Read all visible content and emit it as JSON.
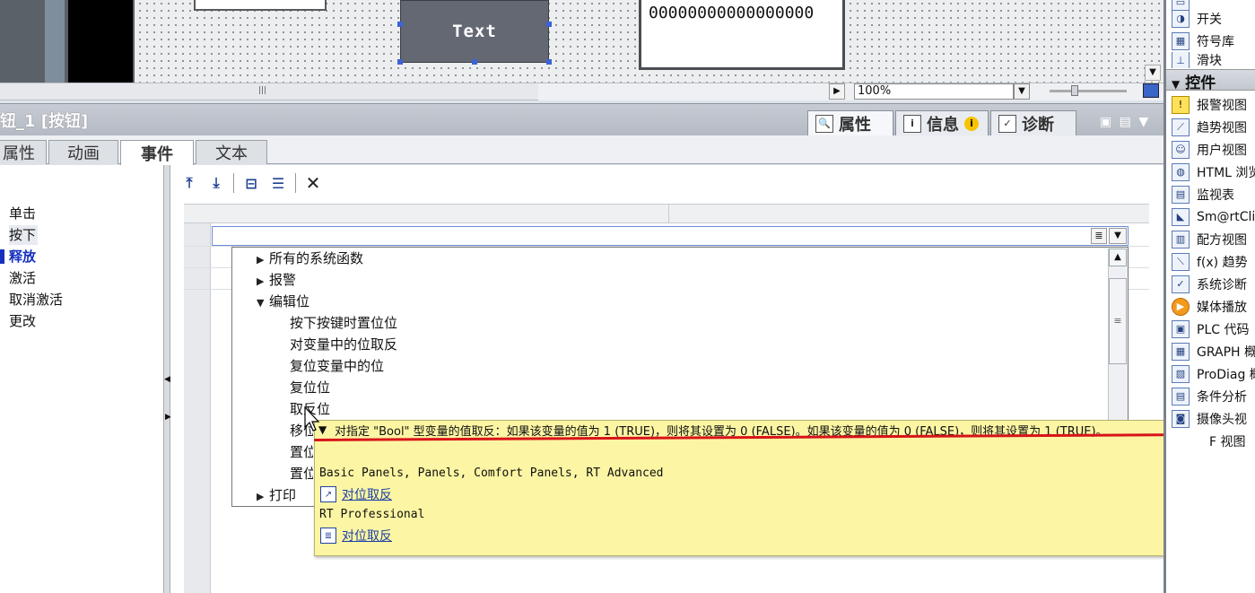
{
  "canvas": {
    "button_text": "Text",
    "io_field_value": "00000000000000000",
    "zoom_value": "100%"
  },
  "properties": {
    "title": "钮_1 [按钮]",
    "tabs": [
      {
        "label": "属性",
        "icon": "properties-icon"
      },
      {
        "label": "信息",
        "icon": "info-icon"
      },
      {
        "label": "诊断",
        "icon": "diagnostics-icon"
      }
    ],
    "subtabs": [
      "属性",
      "动画",
      "事件",
      "文本"
    ]
  },
  "events": [
    "单击",
    "按下",
    "释放",
    "激活",
    "取消激活",
    "更改"
  ],
  "function_list": {
    "items": [
      {
        "label": "所有的系统函数",
        "type": "collapsed"
      },
      {
        "label": "报警",
        "type": "collapsed"
      },
      {
        "label": "编辑位",
        "type": "expanded"
      },
      {
        "label": "按下按键时置位位",
        "type": "child"
      },
      {
        "label": "对变量中的位取反",
        "type": "child"
      },
      {
        "label": "复位变量中的位",
        "type": "child"
      },
      {
        "label": "复位位",
        "type": "child"
      },
      {
        "label": "取反位",
        "type": "child"
      },
      {
        "label": "移位",
        "type": "child"
      },
      {
        "label": "置位",
        "type": "child"
      },
      {
        "label": "置位",
        "type": "child"
      },
      {
        "label": "打印",
        "type": "collapsed"
      }
    ]
  },
  "tooltip": {
    "description": "对指定 \"Bool\" 型变量的值取反：如果该变量的值为 1 (TRUE)，则将其设置为 0 (FALSE)。如果该变量的值为 0 (FALSE)，则将其设置为 1 (TRUE)。",
    "panels_line": "Basic Panels, Panels, Comfort Panels, RT Advanced",
    "link1": "对位取反",
    "rt_line": "RT Professional",
    "link2": "对位取反"
  },
  "toolbox": {
    "items_top": [
      {
        "label": "开关",
        "icon": "switch-icon"
      },
      {
        "label": "符号库",
        "icon": "symbol-library-icon"
      },
      {
        "label": "滑块",
        "icon": "slider-icon"
      }
    ],
    "section": "控件",
    "items": [
      {
        "label": "报警视图",
        "icon": "alarm-view-icon"
      },
      {
        "label": "趋势视图",
        "icon": "trend-view-icon"
      },
      {
        "label": "用户视图",
        "icon": "user-view-icon"
      },
      {
        "label": "HTML 浏览",
        "icon": "html-browser-icon"
      },
      {
        "label": "监视表",
        "icon": "watch-table-icon"
      },
      {
        "label": "Sm@rtClie",
        "icon": "smartclient-icon"
      },
      {
        "label": "配方视图",
        "icon": "recipe-view-icon"
      },
      {
        "label": "f(x) 趋势",
        "icon": "fx-trend-icon"
      },
      {
        "label": "系统诊断",
        "icon": "system-diagnostics-icon"
      },
      {
        "label": "媒体播放",
        "icon": "media-player-icon"
      },
      {
        "label": "PLC 代码",
        "icon": "plc-code-icon"
      },
      {
        "label": "GRAPH 概",
        "icon": "graph-overview-icon"
      },
      {
        "label": "ProDiag 概",
        "icon": "prodiag-icon"
      },
      {
        "label": "条件分析",
        "icon": "criteria-analysis-icon"
      },
      {
        "label": "摄像头视",
        "icon": "camera-view-icon"
      },
      {
        "label": "F 视图",
        "icon": "pdf-view-icon"
      }
    ]
  }
}
